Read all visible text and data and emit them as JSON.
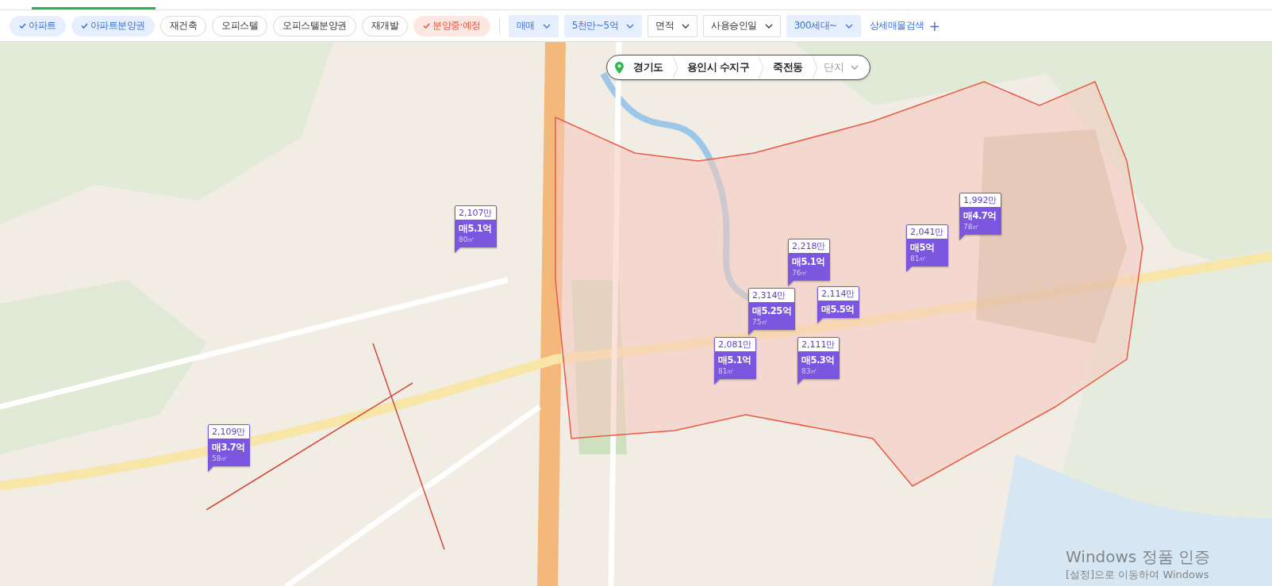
{
  "property_types": [
    {
      "label": "아파트",
      "selected": true,
      "kind": "type"
    },
    {
      "label": "아파트분양권",
      "selected": true,
      "kind": "type"
    },
    {
      "label": "재건축",
      "selected": false,
      "kind": "type"
    },
    {
      "label": "오피스텔",
      "selected": false,
      "kind": "type"
    },
    {
      "label": "오피스텔분양권",
      "selected": false,
      "kind": "type"
    },
    {
      "label": "재개발",
      "selected": false,
      "kind": "type"
    },
    {
      "label": "분양중·예정",
      "selected": true,
      "kind": "sale"
    }
  ],
  "filters": [
    {
      "label": "매매",
      "selected": true
    },
    {
      "label": "5천만~5억",
      "selected": true
    },
    {
      "label": "면적",
      "selected": false
    },
    {
      "label": "사용승인일",
      "selected": false
    },
    {
      "label": "300세대~",
      "selected": true
    }
  ],
  "detail_search": {
    "label": "상세매물검색",
    "icon": "+"
  },
  "breadcrumb": {
    "items": [
      "경기도",
      "용인시 수지구",
      "죽전동"
    ],
    "placeholder": "단지"
  },
  "markers": [
    {
      "total": "1,992만",
      "price": "매4.7억",
      "area": "78㎡"
    },
    {
      "total": "2,107만",
      "price": "매5.1억",
      "area": "80㎡"
    },
    {
      "total": "2,041만",
      "price": "매5억",
      "area": "81㎡"
    },
    {
      "total": "2,218만",
      "price": "매5.1억",
      "area": "76㎡"
    },
    {
      "total": "2,314만",
      "price": "매5.25억",
      "area": "75㎡"
    },
    {
      "total": "2,114만",
      "price": "매5.5억"
    },
    {
      "total": "2,081만",
      "price": "매5.1억",
      "area": "81㎡"
    },
    {
      "total": "2,111만",
      "price": "매5.3억",
      "area": "83㎡"
    },
    {
      "total": "2,109만",
      "price": "매3.7억",
      "area": "58㎡"
    }
  ],
  "os_notice": {
    "title": "Windows 정품 인증",
    "hint": "[설정]으로 이동하여 Windows"
  }
}
